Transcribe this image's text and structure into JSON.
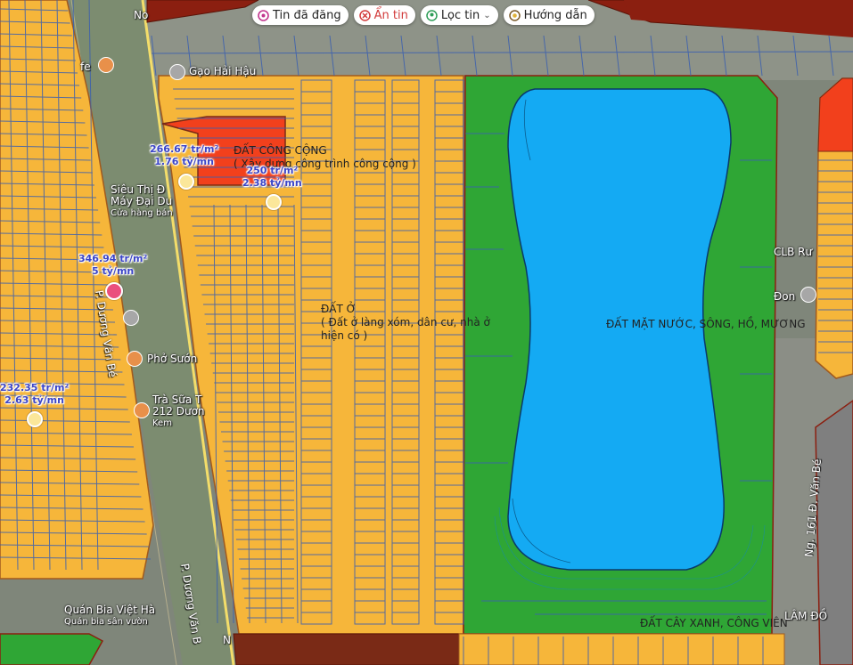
{
  "toolbar": {
    "chips": [
      {
        "label": "Tin đã đăng",
        "icon": "posted-icon"
      },
      {
        "label": "Ẩn tin",
        "icon": "hide-icon"
      },
      {
        "label": "Lọc tin",
        "icon": "filter-pin-icon"
      },
      {
        "label": "Hướng dẫn",
        "icon": "guide-icon"
      }
    ]
  },
  "zones": {
    "public": {
      "title": "ĐẤT CÔNG CỘNG",
      "subtitle": "( Xây dựng công trình công cộng )"
    },
    "residential": {
      "title": "ĐẤT Ở",
      "subtitle": "( Đất ở làng xóm, dân cư, nhà ở",
      "subtitle2": "hiện có )"
    },
    "water": {
      "title": "ĐẤT MẶT NƯỚC, SÔNG, HỒ, MƯƠNG"
    },
    "green": {
      "title": "ĐẤT CÂY XANH, CÔNG VIÊN"
    }
  },
  "prices": [
    {
      "per_m2": "266.67 tr/m²",
      "total": "1.76 tỷ/mn"
    },
    {
      "per_m2": "250 tr/m²",
      "total": "2.38 tỷ/mn"
    },
    {
      "per_m2": "346.94 tr/m²",
      "total": "5 tỷ/mn"
    },
    {
      "per_m2": "232.35 tr/m²",
      "total": "2.63 tỷ/mn"
    }
  ],
  "pois": {
    "gao": "Gạo Hải Hậu",
    "sieuthi1": "Siêu Thị Đ",
    "sieuthi2": "Máy Đại Du",
    "sieuthi3": "Cửa hàng bán",
    "pho": "Phở Sướn",
    "trasua1": "Trà Sữa T",
    "trasua2": "212 Dươn",
    "trasua3": "Kem",
    "quanbia1": "Quán Bia Việt Hà",
    "quanbia2": "Quán bia sân vườn",
    "clb": "CLB Rư",
    "don": "Đon",
    "cafe": "fe",
    "no": "No",
    "lamdo": "LÂM ĐỒ",
    "n": "N"
  },
  "streets": {
    "duong_van_be_1": "P. Dương Văn Bé",
    "duong_van_be_2": "P. Dương Văn B",
    "ng161": "Ng. 161 Đ. Văn Bé"
  },
  "colors": {
    "residential": "#f6b63a",
    "water": "#14aaf3",
    "green": "#2fa635",
    "public": "#f2401c",
    "darkred": "#8b1f10",
    "brown": "#7a2a16",
    "parcel_line": "#3a5fb0"
  }
}
